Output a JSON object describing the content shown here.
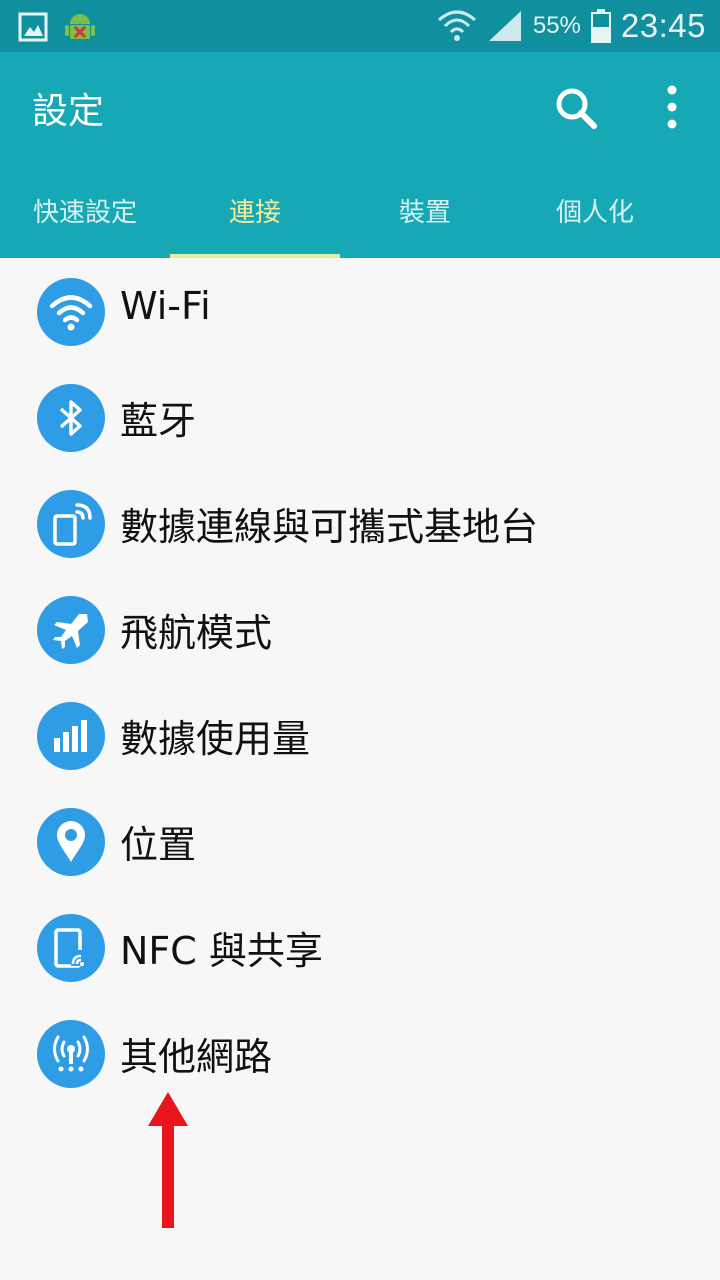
{
  "status_bar": {
    "battery_percent": "55%",
    "time": "23:45",
    "icons": [
      "gallery-icon",
      "android-debug-icon",
      "wifi-icon",
      "signal-icon",
      "battery-icon"
    ]
  },
  "app_bar": {
    "title": "設定",
    "icons": [
      "search-icon",
      "more-vert-icon"
    ]
  },
  "tabs": [
    {
      "label": "快速設定",
      "active": false
    },
    {
      "label": "連接",
      "active": true
    },
    {
      "label": "裝置",
      "active": false
    },
    {
      "label": "個人化",
      "active": false
    }
  ],
  "settings": [
    {
      "label": "Wi-Fi",
      "icon": "wifi-icon"
    },
    {
      "label": "藍牙",
      "icon": "bluetooth-icon"
    },
    {
      "label": "數據連線與可攜式基地台",
      "icon": "hotspot-icon"
    },
    {
      "label": "飛航模式",
      "icon": "airplane-icon"
    },
    {
      "label": "數據使用量",
      "icon": "data-usage-icon"
    },
    {
      "label": "位置",
      "icon": "location-icon"
    },
    {
      "label": "NFC 與共享",
      "icon": "nfc-icon"
    },
    {
      "label": "其他網路",
      "icon": "antenna-icon"
    }
  ],
  "colors": {
    "status_bar": "#108f9e",
    "app_bar": "#17a8b5",
    "active_tab": "#f3ec9a",
    "icon_circle": "#2e9de6",
    "annotation_arrow": "#e8161c"
  }
}
